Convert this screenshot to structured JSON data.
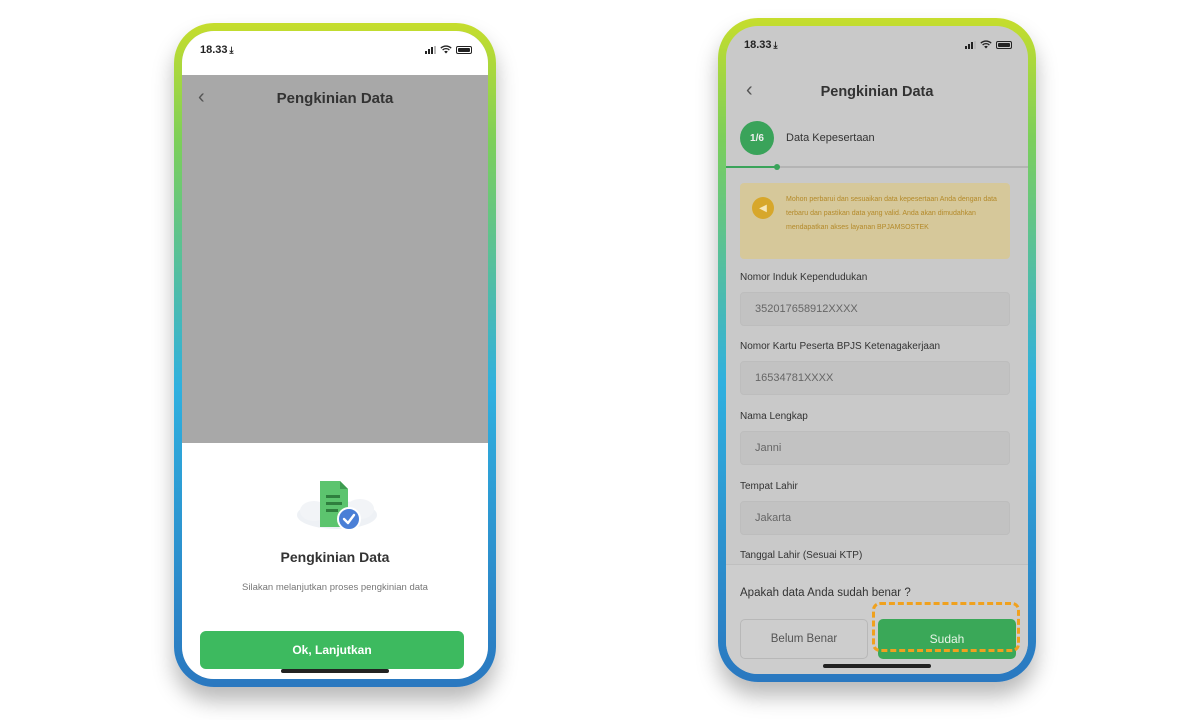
{
  "left_phone": {
    "status_time": "18.33",
    "header_title": "Pengkinian Data",
    "sheet": {
      "icon": "document-check-icon",
      "title": "Pengkinian Data",
      "subtitle": "Silakan melanjutkan proses pengkinian data",
      "button_label": "Ok, Lanjutkan"
    }
  },
  "right_phone": {
    "status_time": "18.33",
    "header_title": "Pengkinian Data",
    "step": {
      "badge": "1/6",
      "label": "Data Kepesertaan",
      "progress_fraction": 0.17
    },
    "warning": {
      "icon": "megaphone-icon",
      "text": "Mohon perbarui dan sesuaikan data kepesertaan Anda dengan data terbaru dan pastikan data yang valid. Anda akan dimudahkan mendapatkan akses layanan BPJAMSOSTEK"
    },
    "fields": [
      {
        "label": "Nomor Induk Kependudukan",
        "value": "352017658912XXXX"
      },
      {
        "label": "Nomor Kartu Peserta BPJS Ketenagakerjaan",
        "value": "16534781XXXX"
      },
      {
        "label": "Nama Lengkap",
        "value": "Janni"
      },
      {
        "label": "Tempat Lahir",
        "value": "Jakarta"
      },
      {
        "label": "Tanggal Lahir (Sesuai KTP)",
        "value": ""
      }
    ],
    "confirm": {
      "question": "Apakah data Anda sudah benar ?",
      "no_label": "Belum Benar",
      "yes_label": "Sudah"
    },
    "colors": {
      "accent_green": "#3aa858",
      "highlight_orange": "#f0a11e"
    }
  }
}
